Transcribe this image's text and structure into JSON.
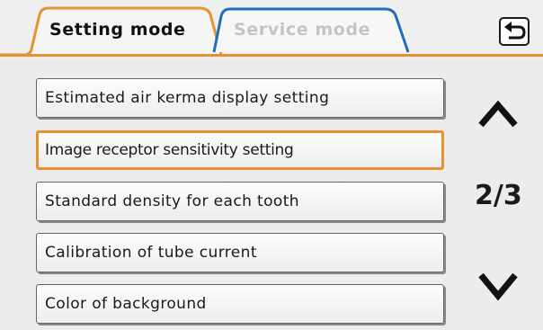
{
  "tabs": [
    {
      "label": "Setting mode",
      "active": true
    },
    {
      "label": "Service mode",
      "active": false
    }
  ],
  "header": {
    "back_icon": "return-arrow-icon"
  },
  "menu": {
    "items": [
      {
        "label": "Estimated air kerma display setting",
        "selected": false
      },
      {
        "label": "Image receptor sensitivity setting",
        "selected": true
      },
      {
        "label": "Standard density for each tooth",
        "selected": false
      },
      {
        "label": "Calibration of tube current",
        "selected": false
      },
      {
        "label": "Color of background",
        "selected": false
      }
    ]
  },
  "pagination": {
    "indicator": "2/3",
    "up_icon": "chevron-up-icon",
    "down_icon": "chevron-down-icon"
  },
  "colors": {
    "accent": "#e8912e",
    "service_tab_border": "#1f6fb8",
    "text": "#1a1a1a"
  }
}
